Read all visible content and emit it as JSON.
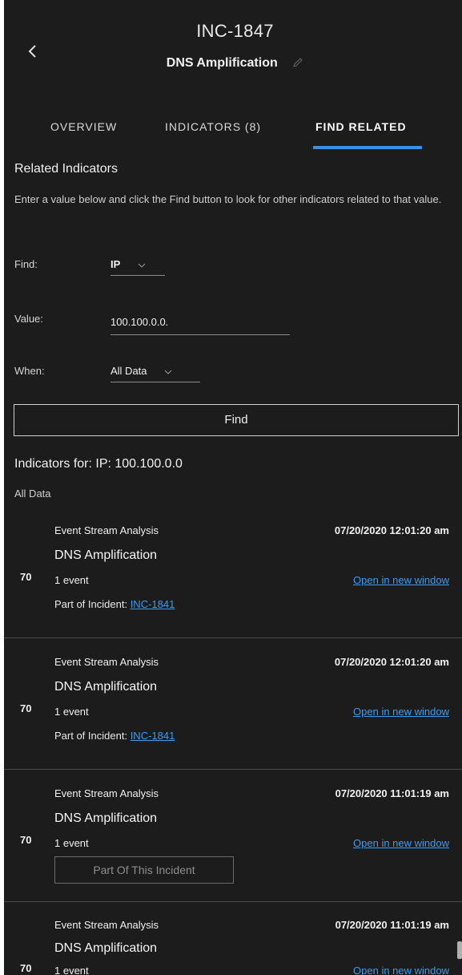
{
  "header": {
    "incident_id": "INC-1847",
    "incident_title": "DNS Amplification"
  },
  "tabs": [
    {
      "label": "OVERVIEW",
      "active": false
    },
    {
      "label": "INDICATORS (8)",
      "active": false
    },
    {
      "label": "FIND RELATED",
      "active": true
    }
  ],
  "find_related": {
    "title": "Related Indicators",
    "description": "Enter a value below and click the Find button to look for other indicators related to that value.",
    "find_label": "Find:",
    "find_value": "IP",
    "value_label": "Value:",
    "value_input": "100.100.0.0.",
    "when_label": "When:",
    "when_value": "All Data",
    "find_button": "Find"
  },
  "results": {
    "heading": "Indicators for: IP: 100.100.0.0",
    "range": "All Data",
    "items": [
      {
        "score": "70",
        "source": "Event Stream Analysis",
        "name": "DNS Amplification",
        "events": "1 event",
        "timestamp": "07/20/2020 12:01:20 am",
        "open_link": "Open in new window",
        "part_of_label": "Part of Incident:",
        "part_of_incident": "INC-1841"
      },
      {
        "score": "70",
        "source": "Event Stream Analysis",
        "name": "DNS Amplification",
        "events": "1 event",
        "timestamp": "07/20/2020 12:01:20 am",
        "open_link": "Open in new window",
        "part_of_label": "Part of Incident:",
        "part_of_incident": "INC-1841"
      },
      {
        "score": "70",
        "source": "Event Stream Analysis",
        "name": "DNS Amplification",
        "events": "1 event",
        "timestamp": "07/20/2020 11:01:19 am",
        "open_link": "Open in new window",
        "part_of_button": "Part Of This Incident"
      },
      {
        "score": "70",
        "source": "Event Stream Analysis",
        "name": "DNS Amplification",
        "events": "1 event",
        "timestamp": "07/20/2020 11:01:19 am",
        "open_link": "Open in new window"
      }
    ]
  },
  "colors": {
    "background": "#1c1c1c",
    "accent": "#3a8fe0",
    "link": "#3a9cf0"
  },
  "icons": {
    "back": "chevron-left-icon",
    "edit": "pencil-icon",
    "dropdown": "chevron-down-icon"
  }
}
